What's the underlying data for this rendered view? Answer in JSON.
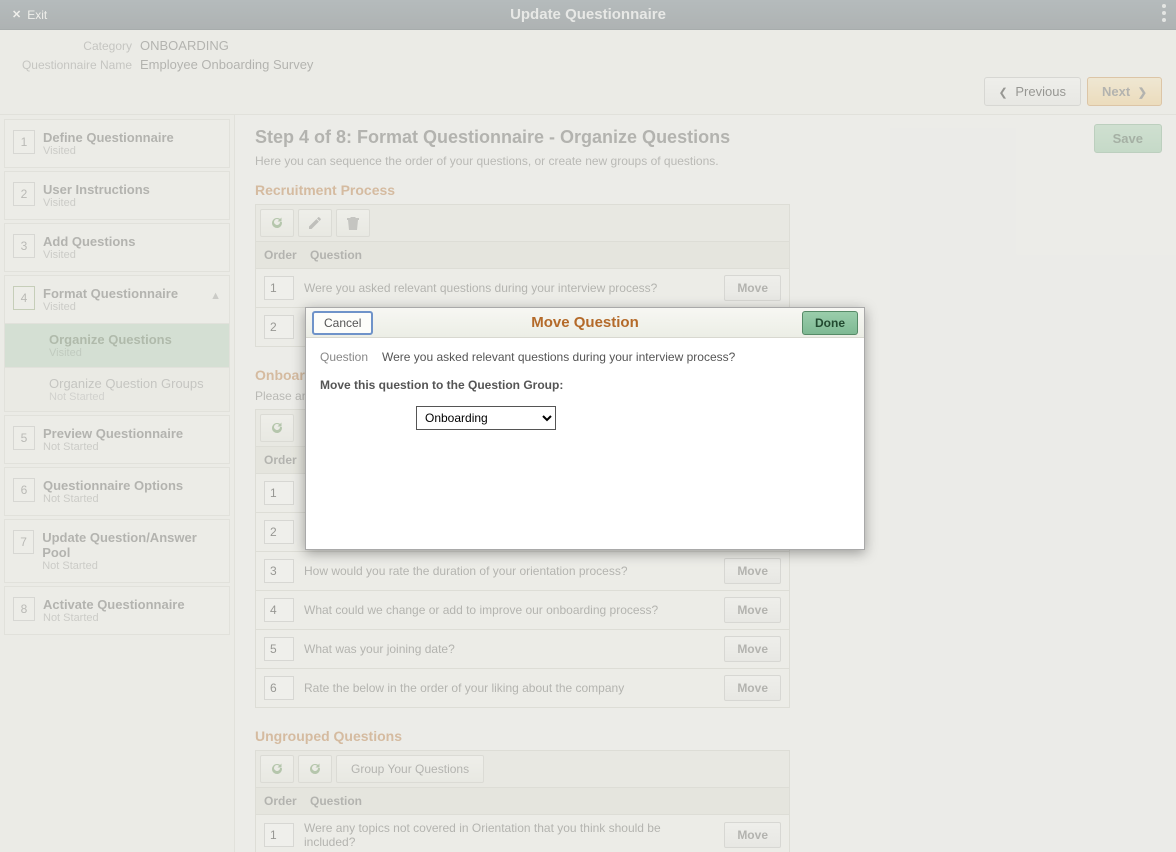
{
  "titlebar": {
    "exit": "Exit",
    "title": "Update Questionnaire"
  },
  "info": {
    "category_label": "Category",
    "category_value": "ONBOARDING",
    "qname_label": "Questionnaire Name",
    "qname_value": "Employee Onboarding Survey"
  },
  "nav": {
    "previous": "Previous",
    "next": "Next",
    "save": "Save"
  },
  "steps": [
    {
      "num": "1",
      "title": "Define Questionnaire",
      "sub": "Visited"
    },
    {
      "num": "2",
      "title": "User Instructions",
      "sub": "Visited"
    },
    {
      "num": "3",
      "title": "Add Questions",
      "sub": "Visited"
    },
    {
      "num": "4",
      "title": "Format Questionnaire",
      "sub": "Visited",
      "current": true
    },
    {
      "num": "5",
      "title": "Preview Questionnaire",
      "sub": "Not Started"
    },
    {
      "num": "6",
      "title": "Questionnaire Options",
      "sub": "Not Started"
    },
    {
      "num": "7",
      "title": "Update Question/Answer Pool",
      "sub": "Not Started"
    },
    {
      "num": "8",
      "title": "Activate Questionnaire",
      "sub": "Not Started"
    }
  ],
  "substeps": [
    {
      "title": "Organize Questions",
      "sub": "Visited",
      "active": true
    },
    {
      "title": "Organize Question Groups",
      "sub": "Not Started"
    }
  ],
  "page": {
    "step_title": "Step 4 of 8: Format Questionnaire - Organize Questions",
    "step_desc": "Here you can sequence the order of your questions, or create new groups of questions."
  },
  "columns": {
    "order": "Order",
    "question": "Question"
  },
  "group_button": "Group Your Questions",
  "move_label": "Move",
  "groups": [
    {
      "title": "Recruitment Process",
      "desc": "",
      "toolbar": [
        "refresh",
        "edit",
        "delete"
      ],
      "questions": [
        {
          "order": "1",
          "text": "Were you asked relevant questions during your interview process?"
        },
        {
          "order": "2",
          "text": ""
        }
      ]
    },
    {
      "title": "Onboard",
      "desc": "Please an",
      "toolbar": [
        "refresh"
      ],
      "questions": [
        {
          "order": "1",
          "text": ""
        },
        {
          "order": "2",
          "text": ""
        },
        {
          "order": "3",
          "text": "How would you rate the duration of your orientation process?"
        },
        {
          "order": "4",
          "text": "What could we change or add to improve our onboarding process?"
        },
        {
          "order": "5",
          "text": "What was your joining date?"
        },
        {
          "order": "6",
          "text": "Rate the below in the order of your liking about the company"
        }
      ]
    },
    {
      "title": "Ungrouped Questions",
      "desc": "",
      "toolbar": [
        "refresh",
        "group"
      ],
      "questions": [
        {
          "order": "1",
          "text": "Were any topics not covered in Orientation that you think should be included?"
        }
      ]
    }
  ],
  "dialog": {
    "cancel": "Cancel",
    "done": "Done",
    "title": "Move Question",
    "question_label": "Question",
    "question_text": "Were you asked relevant questions during your interview process?",
    "move_prompt": "Move this question to the Question Group:",
    "selected_group": "Onboarding",
    "group_options": [
      "Onboarding"
    ]
  }
}
